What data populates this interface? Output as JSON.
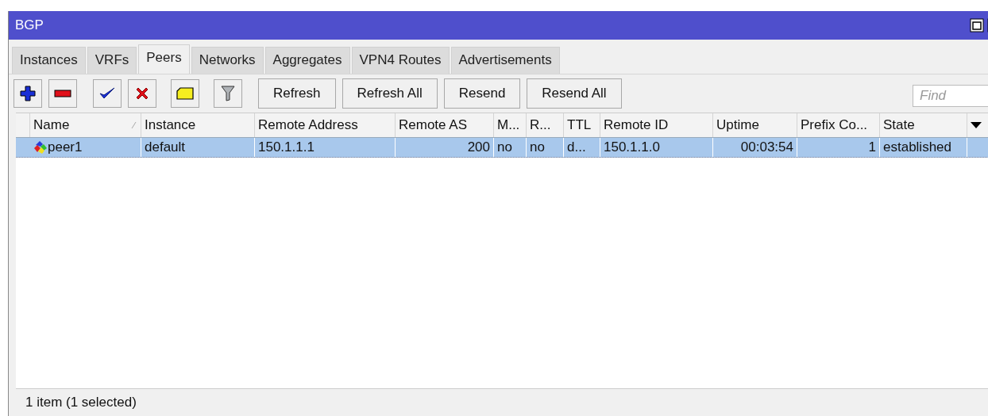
{
  "window": {
    "title": "BGP"
  },
  "tabs": [
    {
      "label": "Instances",
      "selected": false
    },
    {
      "label": "VRFs",
      "selected": false
    },
    {
      "label": "Peers",
      "selected": true
    },
    {
      "label": "Networks",
      "selected": false
    },
    {
      "label": "Aggregates",
      "selected": false
    },
    {
      "label": "VPN4 Routes",
      "selected": false
    },
    {
      "label": "Advertisements",
      "selected": false
    }
  ],
  "toolbar": {
    "icon_buttons": [
      {
        "kind": "add"
      },
      {
        "kind": "remove"
      },
      {
        "kind": "enable"
      },
      {
        "kind": "disable"
      },
      {
        "kind": "comment"
      },
      {
        "kind": "filter"
      }
    ],
    "buttons": [
      "Refresh",
      "Refresh All",
      "Resend",
      "Resend All"
    ],
    "search": {
      "placeholder": "Find"
    }
  },
  "table": {
    "columns": [
      {
        "label": "Name",
        "sorted": true
      },
      {
        "label": "Instance",
        "sorted": false
      },
      {
        "label": "Remote Address",
        "sorted": false
      },
      {
        "label": "Remote AS",
        "sorted": false
      },
      {
        "label": "M...",
        "sorted": false
      },
      {
        "label": "R...",
        "sorted": false
      },
      {
        "label": "TTL",
        "sorted": false
      },
      {
        "label": "Remote ID",
        "sorted": false
      },
      {
        "label": "Uptime",
        "sorted": false
      },
      {
        "label": "Prefix Co...",
        "sorted": false
      },
      {
        "label": "State",
        "sorted": false
      }
    ],
    "rows": [
      {
        "selected": true,
        "cells": [
          "peer1",
          "default",
          "150.1.1.1",
          "200",
          "no",
          "no",
          "d...",
          "150.1.1.0",
          "00:03:54",
          "1",
          "established"
        ]
      }
    ]
  },
  "status_bar": {
    "text": "1 item (1 selected)"
  }
}
